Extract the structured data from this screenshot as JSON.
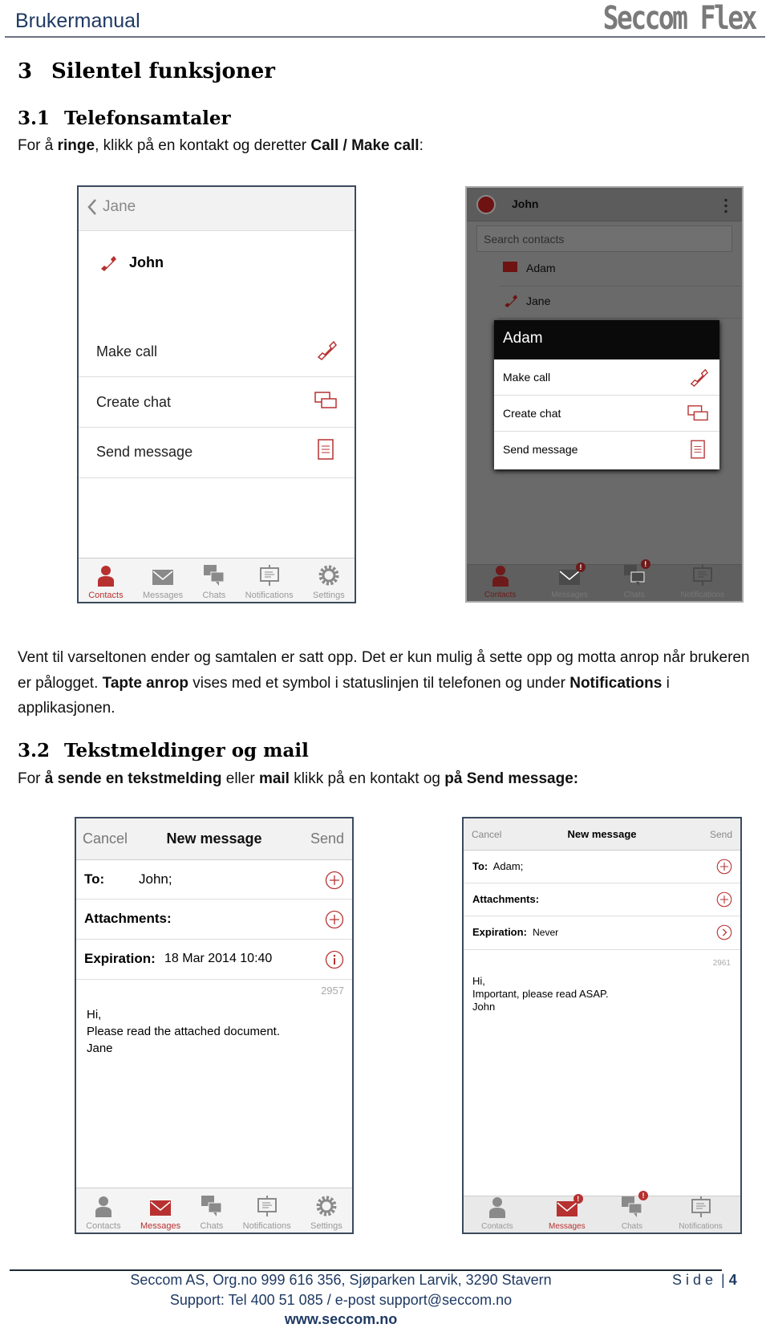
{
  "header": {
    "title": "Brukermanual",
    "brand": "Seccom Flex"
  },
  "section3": {
    "num": "3",
    "title": "Silentel funksjoner"
  },
  "section31": {
    "num": "3.1",
    "title": "Telefonsamtaler",
    "intro": [
      {
        "t": "For å ",
        "b": false
      },
      {
        "t": "ringe",
        "b": true
      },
      {
        "t": ", klikk på en kontakt og deretter ",
        "b": false
      },
      {
        "t": "Call / Make call",
        "b": true
      },
      {
        "t": ":",
        "b": false
      }
    ],
    "after": [
      {
        "t": "Vent til varseltonen ender og samtalen er satt opp. Det er kun mulig å sette opp og motta anrop når brukeren er pålogget. ",
        "b": false
      },
      {
        "t": "Tapte anrop",
        "b": true
      },
      {
        "t": " vises med et symbol i statuslinjen til telefonen og under ",
        "b": false
      },
      {
        "t": "Notifications",
        "b": true
      },
      {
        "t": " i applikasjonen.",
        "b": false
      }
    ]
  },
  "section32": {
    "num": "3.2",
    "title": "Tekstmeldinger og mail",
    "intro": [
      {
        "t": "For ",
        "b": false
      },
      {
        "t": "å sende en tekstmelding",
        "b": true
      },
      {
        "t": " eller ",
        "b": false
      },
      {
        "t": "mail",
        "b": true
      },
      {
        "t": " klikk på en kontakt og ",
        "b": false
      },
      {
        "t": "på Send message:",
        "b": true
      }
    ]
  },
  "phone1": {
    "back": "Jane",
    "contact": "John",
    "actions": [
      "Make call",
      "Create chat",
      "Send message"
    ],
    "tabs": [
      "Contacts",
      "Messages",
      "Chats",
      "Notifications",
      "Settings"
    ]
  },
  "phone2": {
    "user": "John",
    "search_placeholder": "Search contacts",
    "contacts": [
      "Adam",
      "Jane"
    ],
    "dialog": {
      "title": "Adam",
      "actions": [
        "Make call",
        "Create chat",
        "Send message"
      ]
    },
    "tabs": [
      "Contacts",
      "Messages",
      "Chats",
      "Notifications"
    ]
  },
  "phone3": {
    "cancel": "Cancel",
    "title": "New message",
    "send": "Send",
    "to_label": "To:",
    "to_value": "John;",
    "attachments_label": "Attachments:",
    "expiration_label": "Expiration:",
    "expiration_value": "18 Mar 2014 10:40",
    "counter": "2957",
    "body": [
      "Hi,",
      "Please read the attached document.",
      "Jane"
    ],
    "tabs": [
      "Contacts",
      "Messages",
      "Chats",
      "Notifications",
      "Settings"
    ]
  },
  "phone4": {
    "cancel": "Cancel",
    "title": "New message",
    "send": "Send",
    "to_label": "To:",
    "to_value": "Adam;",
    "attachments_label": "Attachments:",
    "expiration_label": "Expiration:",
    "expiration_value": "Never",
    "counter": "2961",
    "body": [
      "Hi,",
      "Important, please read ASAP.",
      "John"
    ],
    "tabs": [
      "Contacts",
      "Messages",
      "Chats",
      "Notifications"
    ]
  },
  "footer": {
    "line1": "Seccom AS, Org.no 999 616 356, Sjøparken Larvik, 3290 Stavern",
    "line2": "Support: Tel 400 51 085 / e-post support@seccom.no",
    "line3": "www.seccom.no",
    "page_label": "S i d e",
    "page_num": "4"
  },
  "colors": {
    "accent": "#b73131",
    "heading_blue": "#1f3a63",
    "brand_gray": "#7a7a7a"
  }
}
